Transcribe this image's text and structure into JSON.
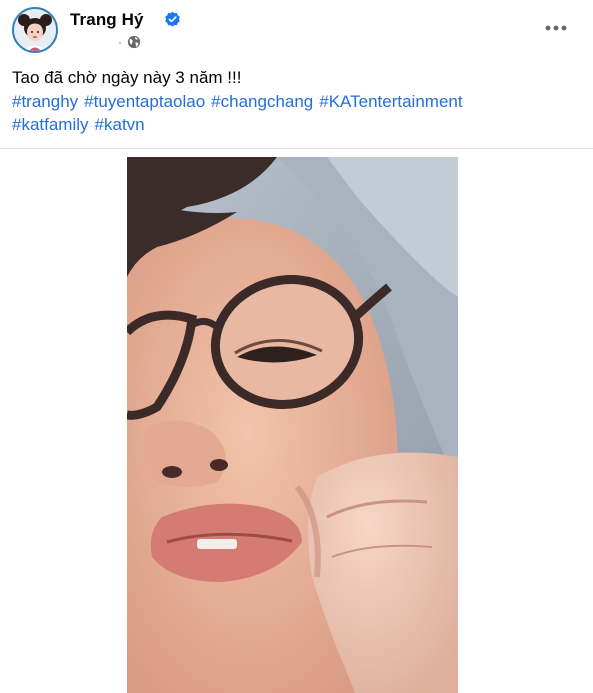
{
  "post": {
    "author": {
      "name": "Trang Hý",
      "verified_icon": "verified-badge-icon",
      "privacy_icon": "globe-icon",
      "meta_separator": "·"
    },
    "more_icon": "more-horizontal-icon",
    "caption": "Tao đã chờ ngày này 3 năm !!!",
    "hashtags": {
      "row1": [
        "#tranghy",
        "#tuyentaptaolao",
        "#changchang",
        "#KATentertainment"
      ],
      "row2": [
        "#katfamily",
        "#katvn"
      ]
    },
    "colors": {
      "link": "#216fdb",
      "verified": "#1877f2",
      "text": "#050505",
      "meta": "#65676b"
    }
  }
}
